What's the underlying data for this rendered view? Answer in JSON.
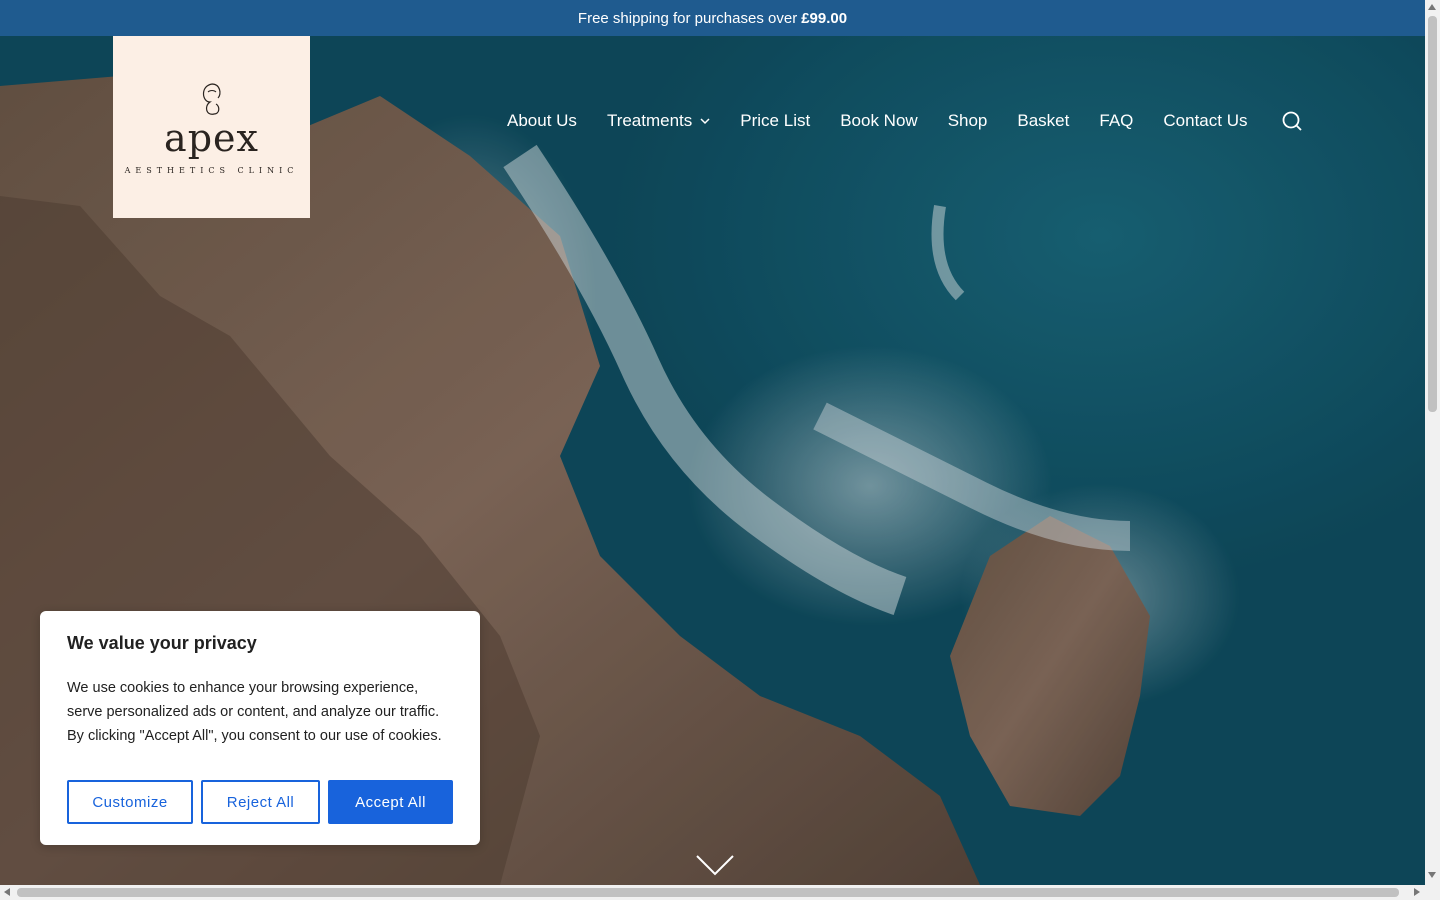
{
  "announcement": {
    "text": "Free shipping for purchases over",
    "amount": "£99.00"
  },
  "logo": {
    "word": "apex",
    "subtitle": "AESTHETICS CLINIC"
  },
  "nav": {
    "items": [
      {
        "label": "About Us"
      },
      {
        "label": "Treatments"
      },
      {
        "label": "Price List"
      },
      {
        "label": "Book Now"
      },
      {
        "label": "Shop"
      },
      {
        "label": "Basket"
      },
      {
        "label": "FAQ"
      },
      {
        "label": "Contact Us"
      }
    ],
    "search_icon": "search-icon"
  },
  "cookie_banner": {
    "title": "We value your privacy",
    "body": "We use cookies to enhance your browsing experience, serve personalized ads or content, and analyze our traffic. By clicking \"Accept All\", you consent to our use of cookies.",
    "customize_label": "Customize",
    "reject_label": "Reject All",
    "accept_label": "Accept All",
    "accent_color": "#1863dc"
  },
  "colors": {
    "announcement_bg": "#1f5b8f",
    "logo_bg": "#fcefe5"
  }
}
